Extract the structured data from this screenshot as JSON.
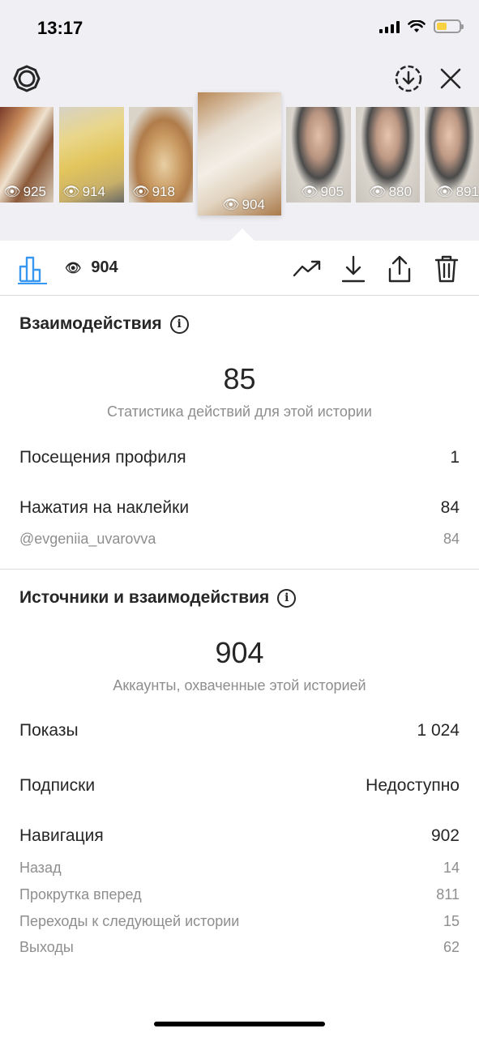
{
  "status_bar": {
    "time": "13:17"
  },
  "thumbnails": [
    {
      "views": "925"
    },
    {
      "views": "914"
    },
    {
      "views": "918"
    },
    {
      "views": "904"
    },
    {
      "views": "905"
    },
    {
      "views": "880"
    },
    {
      "views": "891"
    }
  ],
  "tabbar": {
    "views": "904"
  },
  "interactions": {
    "title": "Взаимодействия",
    "total": "85",
    "caption": "Статистика действий для этой истории",
    "profile_visits_label": "Посещения профиля",
    "profile_visits_value": "1",
    "sticker_taps_label": "Нажатия на наклейки",
    "sticker_taps_value": "84",
    "mention_label": "@evgeniia_uvarovva",
    "mention_value": "84"
  },
  "discovery": {
    "title": "Источники и взаимодействия",
    "reach": "904",
    "caption": "Аккаунты, охваченные этой историей",
    "impressions_label": "Показы",
    "impressions_value": "1 024",
    "follows_label": "Подписки",
    "follows_value": "Недоступно",
    "navigation_label": "Навигация",
    "navigation_value": "902",
    "back_label": "Назад",
    "back_value": "14",
    "forward_label": "Прокрутка вперед",
    "forward_value": "811",
    "next_story_label": "Переходы к следующей истории",
    "next_story_value": "15",
    "exits_label": "Выходы",
    "exits_value": "62"
  },
  "colors": {
    "accent": "#3897f0",
    "secondary_text": "#8e8e8e",
    "primary_text": "#262626",
    "top_background": "#efeff4"
  }
}
